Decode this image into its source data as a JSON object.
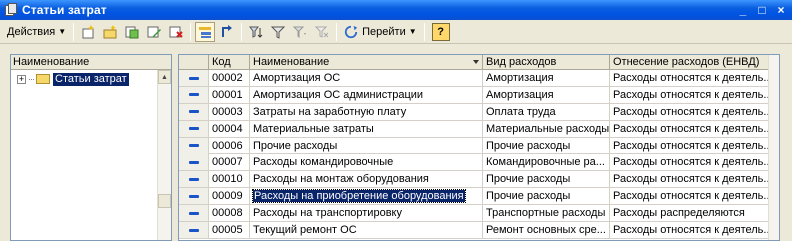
{
  "window": {
    "title": "Статьи затрат"
  },
  "toolbar": {
    "actions_label": "Действия",
    "goto_label": "Перейти",
    "help_label": "?"
  },
  "tree": {
    "header": "Наименование",
    "root_label": "Статьи затрат"
  },
  "table": {
    "columns": [
      "Код",
      "Наименование",
      "Вид расходов",
      "Отнесение расходов (ЕНВД)"
    ],
    "rows": [
      {
        "code": "00002",
        "name": "Амортизация ОС",
        "type": "Амортизация",
        "relation": "Расходы относятся к деятель..."
      },
      {
        "code": "00001",
        "name": "Амортизация ОС администрации",
        "type": "Амортизация",
        "relation": "Расходы относятся к деятель..."
      },
      {
        "code": "00003",
        "name": "Затраты на заработную плату",
        "type": "Оплата труда",
        "relation": "Расходы относятся к деятель..."
      },
      {
        "code": "00004",
        "name": "Материальные затраты",
        "type": "Материальные расходы",
        "relation": "Расходы относятся к деятель..."
      },
      {
        "code": "00006",
        "name": "Прочие расходы",
        "type": "Прочие расходы",
        "relation": "Расходы относятся к деятель..."
      },
      {
        "code": "00007",
        "name": "Расходы командировочные",
        "type": "Командировочные ра...",
        "relation": "Расходы относятся к деятель..."
      },
      {
        "code": "00010",
        "name": "Расходы на монтаж оборудования",
        "type": "Прочие расходы",
        "relation": "Расходы относятся к деятель..."
      },
      {
        "code": "00009",
        "name": "Расходы на приобретение оборудования",
        "type": "Прочие расходы",
        "relation": "Расходы относятся к деятель..."
      },
      {
        "code": "00008",
        "name": "Расходы на транспортировку",
        "type": "Транспортные расходы",
        "relation": "Расходы распределяются"
      },
      {
        "code": "00005",
        "name": "Текущий ремонт ОС",
        "type": "Ремонт основных сре...",
        "relation": "Расходы относятся к деятель..."
      }
    ]
  }
}
